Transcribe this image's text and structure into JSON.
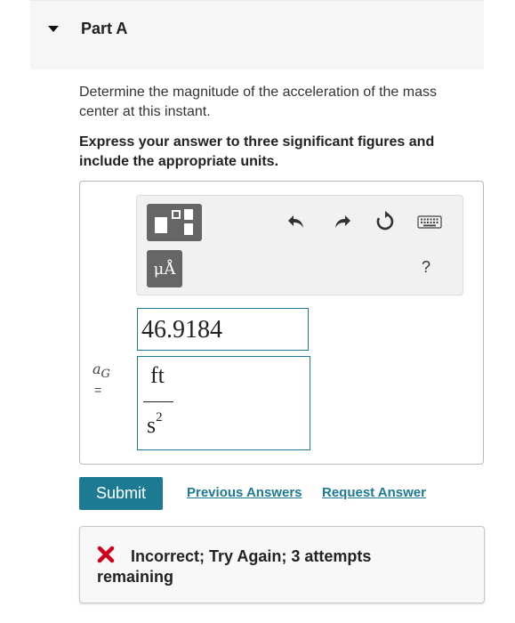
{
  "part": {
    "title": "Part A"
  },
  "question": {
    "text": "Determine the magnitude of the acceleration of the mass center at this instant.",
    "instruction": "Express your answer to three significant figures and include the appropriate units."
  },
  "toolbar": {
    "units_button_label": "μÅ",
    "help_label": "?"
  },
  "answer": {
    "variable_symbol": "aG",
    "equals": "=",
    "value": "46.9184",
    "unit_numerator": "ft",
    "unit_denominator": "s",
    "unit_exponent": "2"
  },
  "actions": {
    "submit_label": "Submit",
    "previous_answers_label": "Previous Answers",
    "request_answer_label": "Request Answer"
  },
  "feedback": {
    "message": "Incorrect; Try Again; 3 attempts remaining",
    "status_color": "#d0021b"
  },
  "colors": {
    "accent": "#1c7a92"
  }
}
